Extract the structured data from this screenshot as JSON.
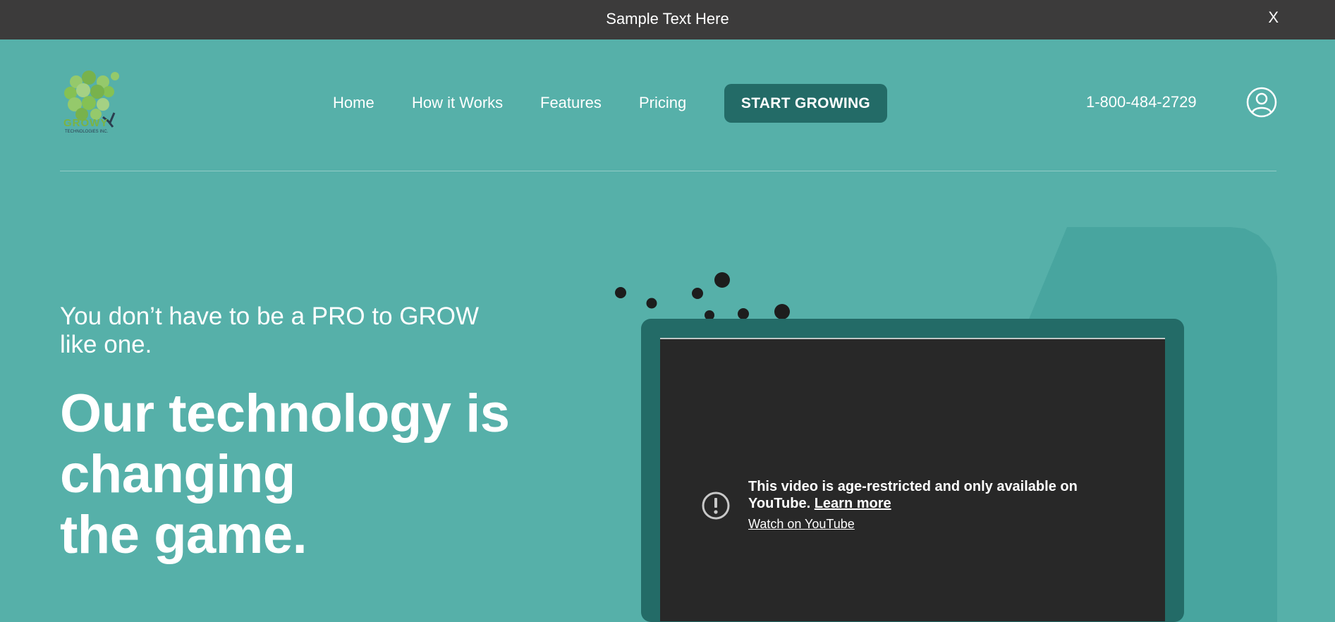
{
  "announcement": {
    "text": "Sample Text Here",
    "close_label": "X"
  },
  "header": {
    "logo": {
      "name": "GROWY",
      "tagline": "TECHNOLOGIES INC."
    },
    "nav": [
      "Home",
      "How it Works",
      "Features",
      "Pricing"
    ],
    "cta_label": "START GROWING",
    "phone": "1-800-484-2729",
    "account_icon": "user-circle-icon"
  },
  "hero": {
    "subheading_line1": "You don’t have to be a PRO to GROW",
    "subheading_line2": "like one.",
    "headline_line1": "Our technology is",
    "headline_line2": "changing",
    "headline_line3": "the game."
  },
  "video": {
    "message": "This video is age-restricted and only available on YouTube.",
    "learn_more": "Learn more",
    "watch_link": "Watch on YouTube",
    "icon": "exclamation-circle-icon"
  },
  "colors": {
    "background": "#56b0a9",
    "topbar": "#3c3b3b",
    "accent": "#236b67",
    "shape": "#48a59f",
    "video_bg": "#282828"
  }
}
